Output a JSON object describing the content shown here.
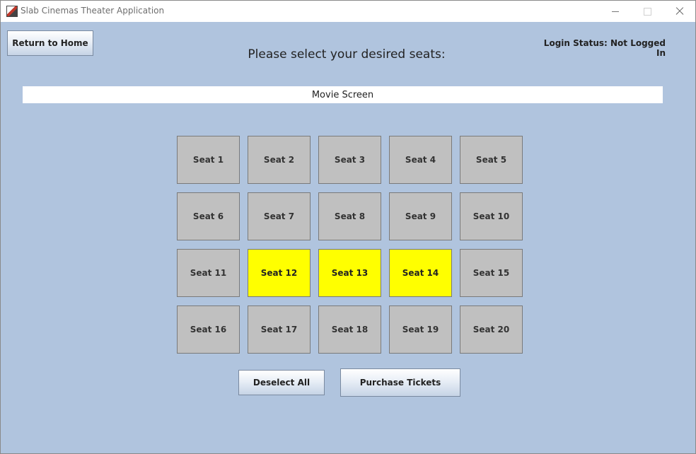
{
  "window": {
    "title": "Slab Cinemas Theater Application",
    "icon": "theater-app-icon"
  },
  "header": {
    "return_label": "Return to Home",
    "heading": "Please select your desired seats:",
    "login_status": "Login Status: Not Logged In"
  },
  "screen_label": "Movie Screen",
  "seats": [
    {
      "label": "Seat 1",
      "selected": false
    },
    {
      "label": "Seat 2",
      "selected": false
    },
    {
      "label": "Seat 3",
      "selected": false
    },
    {
      "label": "Seat 4",
      "selected": false
    },
    {
      "label": "Seat 5",
      "selected": false
    },
    {
      "label": "Seat 6",
      "selected": false
    },
    {
      "label": "Seat 7",
      "selected": false
    },
    {
      "label": "Seat 8",
      "selected": false
    },
    {
      "label": "Seat 9",
      "selected": false
    },
    {
      "label": "Seat 10",
      "selected": false
    },
    {
      "label": "Seat 11",
      "selected": false
    },
    {
      "label": "Seat 12",
      "selected": true
    },
    {
      "label": "Seat 13",
      "selected": true
    },
    {
      "label": "Seat 14",
      "selected": true
    },
    {
      "label": "Seat 15",
      "selected": false
    },
    {
      "label": "Seat 16",
      "selected": false
    },
    {
      "label": "Seat 17",
      "selected": false
    },
    {
      "label": "Seat 18",
      "selected": false
    },
    {
      "label": "Seat 19",
      "selected": false
    },
    {
      "label": "Seat 20",
      "selected": false
    }
  ],
  "actions": {
    "deselect_label": "Deselect All",
    "purchase_label": "Purchase Tickets"
  },
  "colors": {
    "background": "#b0c4de",
    "seat_available": "#c0c0c0",
    "seat_selected": "#ffff00"
  }
}
